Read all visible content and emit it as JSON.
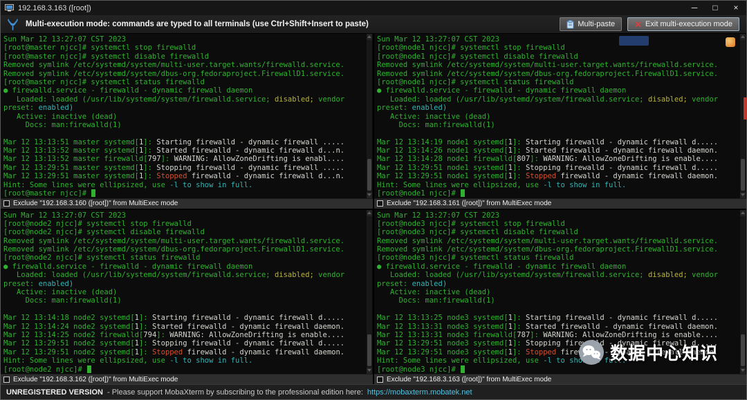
{
  "window": {
    "title": "192.168.3.163 ([root])",
    "controls": {
      "minimize": "─",
      "maximize": "□",
      "close": "×"
    }
  },
  "toolbar": {
    "message": "Multi-execution mode: commands are typed to all terminals (use Ctrl+Shift+Insert to paste)",
    "multi_paste_label": "Multi-paste",
    "exit_label": "Exit multi-execution mode"
  },
  "colors": {
    "terminal_background": "#0c0c0c",
    "terminal_green": "#30b230",
    "terminal_white": "#d3d7cf",
    "terminal_yellow": "#b8b23a",
    "terminal_cyan": "#34b5b5",
    "terminal_red": "#d4502e",
    "accent_blue": "#3f8fd6",
    "exit_red": "#d83a3a",
    "link_cyan": "#53c1de"
  },
  "terminals": [
    {
      "host": "master",
      "exclude_label": "Exclude \"192.168.3.160 ([root])\" from MultiExec mode",
      "cursor": true,
      "lines": [
        [
          [
            "g",
            "Sun Mar 12 13:27:07 CST 2023"
          ]
        ],
        [
          [
            "g",
            "[root@master njcc]# systemctl stop firewalld"
          ]
        ],
        [
          [
            "g",
            "[root@master njcc]# systemctl disable firewalld"
          ]
        ],
        [
          [
            "g",
            "Removed symlink /etc/systemd/system/multi-user.target.wants/firewalld.service."
          ]
        ],
        [
          [
            "g",
            "Removed symlink /etc/systemd/system/dbus-org.fedoraproject.FirewallD1.service."
          ]
        ],
        [
          [
            "g",
            "[root@master njcc]# systemctl status firewalld"
          ]
        ],
        [
          [
            "g",
            "● firewalld.service - firewalld - dynamic firewall daemon"
          ]
        ],
        [
          [
            "g",
            "   Loaded: loaded (/usr/lib/systemd/system/firewalld.service; "
          ],
          [
            "y",
            "disabled;"
          ],
          [
            "g",
            " vendor"
          ]
        ],
        [
          [
            "g",
            "preset: "
          ],
          [
            "c",
            "enabled)"
          ]
        ],
        [
          [
            "g",
            "   Active: inactive (dead)"
          ]
        ],
        [
          [
            "g",
            "     Docs: man:firewalld(1)"
          ]
        ],
        [],
        [
          [
            "g",
            "Mar 12 13:13:51 master systemd["
          ],
          [
            "w",
            "1"
          ],
          [
            "g",
            "]: "
          ],
          [
            "w",
            "Starting firewalld - dynamic firewall ....."
          ]
        ],
        [
          [
            "g",
            "Mar 12 13:13:52 master systemd["
          ],
          [
            "w",
            "1"
          ],
          [
            "g",
            "]: "
          ],
          [
            "w",
            "Started firewalld - dynamic firewall d...n."
          ]
        ],
        [
          [
            "g",
            "Mar 12 13:13:52 master firewalld["
          ],
          [
            "w",
            "797"
          ],
          [
            "g",
            "]: "
          ],
          [
            "w",
            "WARNING: AllowZoneDrifting is enabl...."
          ]
        ],
        [
          [
            "g",
            "Mar 12 13:29:51 master systemd["
          ],
          [
            "w",
            "1"
          ],
          [
            "g",
            "]: "
          ],
          [
            "w",
            "Stopping firewalld - dynamic firewall ....."
          ]
        ],
        [
          [
            "g",
            "Mar 12 13:29:51 master systemd["
          ],
          [
            "w",
            "1"
          ],
          [
            "g",
            "]: "
          ],
          [
            "r",
            "Stopped"
          ],
          [
            "w",
            " firewalld - dynamic firewall d...n."
          ]
        ],
        [
          [
            "g",
            "Hint: Some lines were ellipsized, use "
          ],
          [
            "c",
            "-l to show in full."
          ]
        ],
        [
          [
            "g",
            "[root@master njcc]# "
          ]
        ]
      ]
    },
    {
      "host": "node1",
      "exclude_label": "Exclude \"192.168.3.161 ([root])\" from MultiExec mode",
      "cursor": true,
      "lines": [
        [
          [
            "g",
            "Sun Mar 12 13:27:07 CST 2023"
          ]
        ],
        [
          [
            "g",
            "[root@node1 njcc]# systemctl stop firewalld"
          ]
        ],
        [
          [
            "g",
            "[root@node1 njcc]# systemctl disable firewalld"
          ]
        ],
        [
          [
            "g",
            "Removed symlink /etc/systemd/system/multi-user.target.wants/firewalld.service."
          ]
        ],
        [
          [
            "g",
            "Removed symlink /etc/systemd/system/dbus-org.fedoraproject.FirewallD1.service."
          ]
        ],
        [
          [
            "g",
            "[root@node1 njcc]# systemctl status firewalld"
          ]
        ],
        [
          [
            "g",
            "● firewalld.service - firewalld - dynamic firewall daemon"
          ]
        ],
        [
          [
            "g",
            "   Loaded: loaded (/usr/lib/systemd/system/firewalld.service; "
          ],
          [
            "y",
            "disabled;"
          ],
          [
            "g",
            " vendor"
          ]
        ],
        [
          [
            "g",
            "preset: "
          ],
          [
            "c",
            "enabled)"
          ]
        ],
        [
          [
            "g",
            "   Active: inactive (dead)"
          ]
        ],
        [
          [
            "g",
            "     Docs: man:firewalld(1)"
          ]
        ],
        [],
        [
          [
            "g",
            "Mar 12 13:14:19 node1 systemd["
          ],
          [
            "w",
            "1"
          ],
          [
            "g",
            "]: "
          ],
          [
            "w",
            "Starting firewalld - dynamic firewall d....."
          ]
        ],
        [
          [
            "g",
            "Mar 12 13:14:26 node1 systemd["
          ],
          [
            "w",
            "1"
          ],
          [
            "g",
            "]: "
          ],
          [
            "w",
            "Started firewalld - dynamic firewall daemon."
          ]
        ],
        [
          [
            "g",
            "Mar 12 13:14:28 node1 firewalld["
          ],
          [
            "w",
            "807"
          ],
          [
            "g",
            "]: "
          ],
          [
            "w",
            "WARNING: AllowZoneDrifting is enable...."
          ]
        ],
        [
          [
            "g",
            "Mar 12 13:29:51 node1 systemd["
          ],
          [
            "w",
            "1"
          ],
          [
            "g",
            "]: "
          ],
          [
            "w",
            "Stopping firewalld - dynamic firewall d....."
          ]
        ],
        [
          [
            "g",
            "Mar 12 13:29:51 node1 systemd["
          ],
          [
            "w",
            "1"
          ],
          [
            "g",
            "]: "
          ],
          [
            "r",
            "Stopped"
          ],
          [
            "w",
            " firewalld - dynamic firewall daemon."
          ]
        ],
        [
          [
            "g",
            "Hint: Some lines were ellipsized, use "
          ],
          [
            "c",
            "-l to show in full."
          ]
        ],
        [
          [
            "g",
            "[root@node1 njcc]# "
          ]
        ]
      ]
    },
    {
      "host": "node2",
      "exclude_label": "Exclude \"192.168.3.162 ([root])\" from MultiExec mode",
      "cursor": true,
      "lines": [
        [
          [
            "g",
            "Sun Mar 12 13:27:07 CST 2023"
          ]
        ],
        [
          [
            "g",
            "[root@node2 njcc]# systemctl stop firewalld"
          ]
        ],
        [
          [
            "g",
            "[root@node2 njcc]# systemctl disable firewalld"
          ]
        ],
        [
          [
            "g",
            "Removed symlink /etc/systemd/system/multi-user.target.wants/firewalld.service."
          ]
        ],
        [
          [
            "g",
            "Removed symlink /etc/systemd/system/dbus-org.fedoraproject.FirewallD1.service."
          ]
        ],
        [
          [
            "g",
            "[root@node2 njcc]# systemctl status firewalld"
          ]
        ],
        [
          [
            "g",
            "● firewalld.service - firewalld - dynamic firewall daemon"
          ]
        ],
        [
          [
            "g",
            "   Loaded: loaded (/usr/lib/systemd/system/firewalld.service; "
          ],
          [
            "y",
            "disabled;"
          ],
          [
            "g",
            " vendor"
          ]
        ],
        [
          [
            "g",
            "preset: "
          ],
          [
            "c",
            "enabled)"
          ]
        ],
        [
          [
            "g",
            "   Active: inactive (dead)"
          ]
        ],
        [
          [
            "g",
            "     Docs: man:firewalld(1)"
          ]
        ],
        [],
        [
          [
            "g",
            "Mar 12 13:14:18 node2 systemd["
          ],
          [
            "w",
            "1"
          ],
          [
            "g",
            "]: "
          ],
          [
            "w",
            "Starting firewalld - dynamic firewall d....."
          ]
        ],
        [
          [
            "g",
            "Mar 12 13:14:24 node2 systemd["
          ],
          [
            "w",
            "1"
          ],
          [
            "g",
            "]: "
          ],
          [
            "w",
            "Started firewalld - dynamic firewall daemon."
          ]
        ],
        [
          [
            "g",
            "Mar 12 13:14:25 node2 firewalld["
          ],
          [
            "w",
            "794"
          ],
          [
            "g",
            "]: "
          ],
          [
            "w",
            "WARNING: AllowZoneDrifting is enable...."
          ]
        ],
        [
          [
            "g",
            "Mar 12 13:29:51 node2 systemd["
          ],
          [
            "w",
            "1"
          ],
          [
            "g",
            "]: "
          ],
          [
            "w",
            "Stopping firewalld - dynamic firewall d....."
          ]
        ],
        [
          [
            "g",
            "Mar 12 13:29:51 node2 systemd["
          ],
          [
            "w",
            "1"
          ],
          [
            "g",
            "]: "
          ],
          [
            "r",
            "Stopped"
          ],
          [
            "w",
            " firewalld - dynamic firewall daemon."
          ]
        ],
        [
          [
            "g",
            "Hint: Some lines were ellipsized, use "
          ],
          [
            "c",
            "-l to show in full."
          ]
        ],
        [
          [
            "g",
            "[root@node2 njcc]# "
          ]
        ]
      ]
    },
    {
      "host": "node3",
      "exclude_label": "Exclude \"192.168.3.163 ([root])\" from MultiExec mode",
      "cursor": true,
      "lines": [
        [
          [
            "g",
            "Sun Mar 12 13:27:07 CST 2023"
          ]
        ],
        [
          [
            "g",
            "[root@node3 njcc]# systemctl stop firewalld"
          ]
        ],
        [
          [
            "g",
            "[root@node3 njcc]# systemctl disable firewalld"
          ]
        ],
        [
          [
            "g",
            "Removed symlink /etc/systemd/system/multi-user.target.wants/firewalld.service."
          ]
        ],
        [
          [
            "g",
            "Removed symlink /etc/systemd/system/dbus-org.fedoraproject.FirewallD1.service."
          ]
        ],
        [
          [
            "g",
            "[root@node3 njcc]# systemctl status firewalld"
          ]
        ],
        [
          [
            "g",
            "● firewalld.service - firewalld - dynamic firewall daemon"
          ]
        ],
        [
          [
            "g",
            "   Loaded: loaded (/usr/lib/systemd/system/firewalld.service; "
          ],
          [
            "y",
            "disabled;"
          ],
          [
            "g",
            " vendor"
          ]
        ],
        [
          [
            "g",
            "preset: "
          ],
          [
            "c",
            "enabled)"
          ]
        ],
        [
          [
            "g",
            "   Active: inactive (dead)"
          ]
        ],
        [
          [
            "g",
            "     Docs: man:firewalld(1)"
          ]
        ],
        [],
        [
          [
            "g",
            "Mar 12 13:13:25 node3 systemd["
          ],
          [
            "w",
            "1"
          ],
          [
            "g",
            "]: "
          ],
          [
            "w",
            "Starting firewalld - dynamic firewall d....."
          ]
        ],
        [
          [
            "g",
            "Mar 12 13:13:31 node3 systemd["
          ],
          [
            "w",
            "1"
          ],
          [
            "g",
            "]: "
          ],
          [
            "w",
            "Started firewalld - dynamic firewall daemon."
          ]
        ],
        [
          [
            "g",
            "Mar 12 13:13:31 node3 firewalld["
          ],
          [
            "w",
            "787"
          ],
          [
            "g",
            "]: "
          ],
          [
            "w",
            "WARNING: AllowZoneDrifting is enable...."
          ]
        ],
        [
          [
            "g",
            "Mar 12 13:29:51 node3 systemd["
          ],
          [
            "w",
            "1"
          ],
          [
            "g",
            "]: "
          ],
          [
            "w",
            "Stopping firewalld - dynamic firewall d....."
          ]
        ],
        [
          [
            "g",
            "Mar 12 13:29:51 node3 systemd["
          ],
          [
            "w",
            "1"
          ],
          [
            "g",
            "]: "
          ],
          [
            "r",
            "Stopped"
          ],
          [
            "w",
            " firewalld - dynamic firewall daemon."
          ]
        ],
        [
          [
            "g",
            "Hint: Some lines were ellipsized, use "
          ],
          [
            "c",
            "-l to show in full."
          ]
        ],
        [
          [
            "g",
            "[root@node3 njcc]# "
          ]
        ]
      ]
    }
  ],
  "statusbar": {
    "unregistered": "UNREGISTERED VERSION",
    "note": "- Please support MobaXterm by subscribing to the professional edition here:",
    "link": "https://mobaxterm.mobatek.net"
  },
  "watermark": {
    "text": "数据中心知识"
  }
}
